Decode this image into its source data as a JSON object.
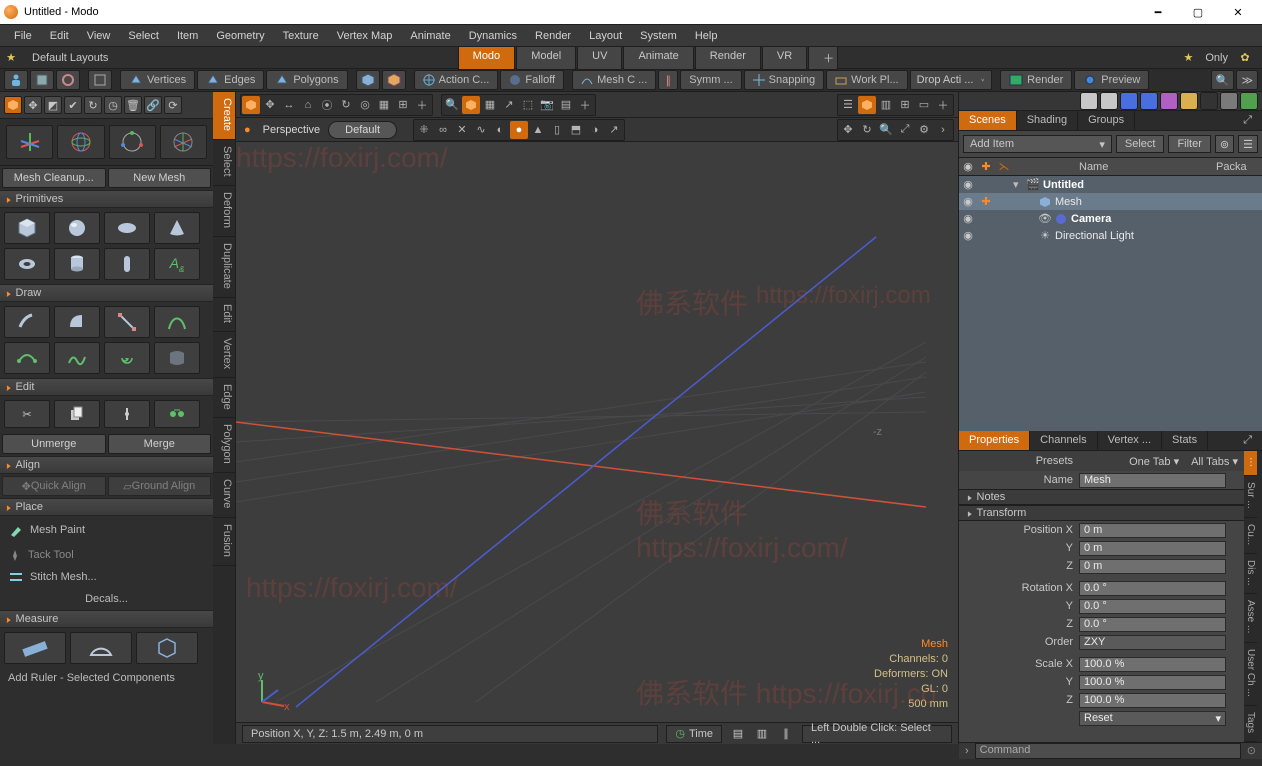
{
  "window": {
    "title": "Untitled - Modo"
  },
  "menu": [
    "File",
    "Edit",
    "View",
    "Select",
    "Item",
    "Geometry",
    "Texture",
    "Vertex Map",
    "Animate",
    "Dynamics",
    "Render",
    "Layout",
    "System",
    "Help"
  ],
  "layoutbar": {
    "label": "Default Layouts",
    "tabs": [
      "Modo",
      "Model",
      "UV",
      "Animate",
      "Render",
      "VR"
    ],
    "active": "Modo",
    "only": "Only"
  },
  "toolstrip": {
    "component_tabs": [
      "Vertices",
      "Edges",
      "Polygons"
    ],
    "action": "Action C...",
    "falloff": "Falloff",
    "meshc": "Mesh C ...",
    "symm": "Symm ...",
    "snapping": "Snapping",
    "workpl": "Work Pl...",
    "dropact": "Drop Acti ...",
    "render": "Render",
    "preview": "Preview"
  },
  "sidetabs": [
    "Create",
    "Select",
    "Deform",
    "Duplicate",
    "Edit",
    "Vertex",
    "Edge",
    "Polygon",
    "Curve",
    "Fusion"
  ],
  "sidetab_active": "Create",
  "toolbox": {
    "mesh_cleanup": "Mesh Cleanup...",
    "new_mesh": "New Mesh",
    "sec_primitives": "Primitives",
    "sec_draw": "Draw",
    "sec_edit": "Edit",
    "sec_align": "Align",
    "sec_place": "Place",
    "sec_measure": "Measure",
    "unmerge": "Unmerge",
    "merge": "Merge",
    "quick_align": "Quick Align",
    "ground_align": "Ground Align",
    "mesh_paint": "Mesh Paint",
    "tack_tool": "Tack Tool",
    "stitch_mesh": "Stitch Mesh...",
    "decals": "Decals...",
    "add_ruler": "Add Ruler - Selected Components"
  },
  "viewportbar": {
    "perspective": "Perspective",
    "view_default": "Default"
  },
  "viewport": {
    "axis_label": "-z",
    "stats": {
      "name": "Mesh",
      "channels": "Channels: 0",
      "deformers": "Deformers: ON",
      "gl": "GL: 0",
      "grid": "500 mm"
    }
  },
  "vp_footer": {
    "pos": "Position X, Y, Z:   1.5 m, 2.49 m, 0 m",
    "time": "Time",
    "tip": "Left Double Click: Select ..."
  },
  "scenes": {
    "tabs": [
      "Scenes",
      "Shading",
      "Groups"
    ],
    "active": "Scenes",
    "add_item": "Add Item",
    "select": "Select",
    "filter": "Filter",
    "cols": {
      "name": "Name",
      "packa": "Packa"
    },
    "items": [
      {
        "name": "Untitled",
        "bold": true,
        "icon": "clapper",
        "depth": 0
      },
      {
        "name": "Mesh",
        "bold": false,
        "icon": "mesh",
        "depth": 1,
        "selected": true
      },
      {
        "name": "Camera",
        "bold": true,
        "icon": "camera",
        "depth": 1
      },
      {
        "name": "Directional Light",
        "bold": false,
        "icon": "light",
        "depth": 1
      }
    ]
  },
  "props": {
    "tabs": [
      "Properties",
      "Channels",
      "Vertex ...",
      "Stats"
    ],
    "active": "Properties",
    "rside": [
      "Sur ...",
      "Cu...",
      "Dis ...",
      "Asse ...",
      "User Ch ...",
      "Tags"
    ],
    "presets_lbl": "Presets",
    "one_tab": "One Tab ▾",
    "all_tabs": "All Tabs ▾",
    "name_lbl": "Name",
    "name_val": "Mesh",
    "notes": "Notes",
    "transform": "Transform",
    "posx_l": "Position X",
    "posx": "0 m",
    "posy_l": "Y",
    "posy": "0 m",
    "posz_l": "Z",
    "posz": "0 m",
    "rotx_l": "Rotation X",
    "rotx": "0.0 °",
    "roty_l": "Y",
    "roty": "0.0 °",
    "rotz_l": "Z",
    "rotz": "0.0 °",
    "order_l": "Order",
    "order": "ZXY",
    "sclx_l": "Scale X",
    "sclx": "100.0 %",
    "scly_l": "Y",
    "scly": "100.0 %",
    "sclz_l": "Z",
    "sclz": "100.0 %",
    "reset": "Reset"
  },
  "cmd": {
    "label": "Command"
  }
}
